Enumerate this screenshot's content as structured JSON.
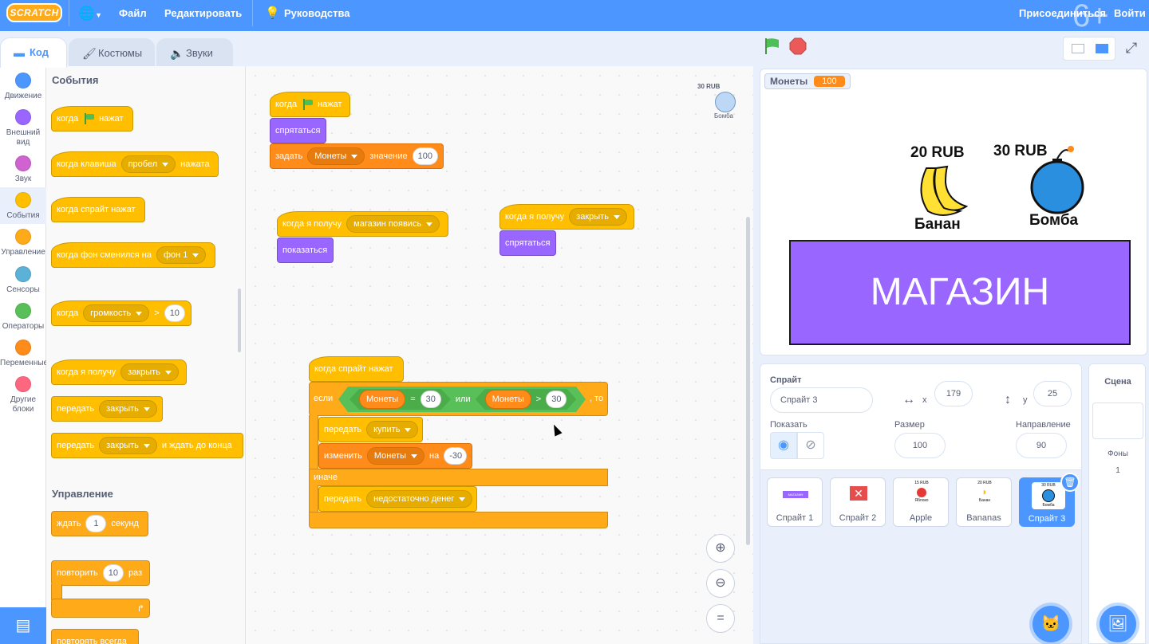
{
  "menubar": {
    "logo": "SCRATCH",
    "file": "Файл",
    "edit": "Редактировать",
    "tutorials": "Руководства",
    "join": "Присоединиться",
    "signin": "Войти",
    "age_badge": "6+"
  },
  "tabs": {
    "code": "Код",
    "costumes": "Костюмы",
    "sounds": "Звуки"
  },
  "categories": [
    {
      "label": "Движение",
      "color": "#4c97ff"
    },
    {
      "label": "Внешний вид",
      "color": "#9966ff"
    },
    {
      "label": "Звук",
      "color": "#cf63cf"
    },
    {
      "label": "События",
      "color": "#ffbf00"
    },
    {
      "label": "Управление",
      "color": "#ffab19"
    },
    {
      "label": "Сенсоры",
      "color": "#5cb1d6"
    },
    {
      "label": "Операторы",
      "color": "#59c059"
    },
    {
      "label": "Переменные",
      "color": "#ff8c1a"
    },
    {
      "label": "Другие блоки",
      "color": "#ff6680"
    }
  ],
  "palette": {
    "events_heading": "События",
    "control_heading": "Управление",
    "b1": {
      "when": "когда",
      "clicked": "нажат"
    },
    "b2": {
      "when": "когда клавиша",
      "key": "пробел",
      "pressed": "нажата"
    },
    "b3": {
      "text": "когда спрайт нажат"
    },
    "b4": {
      "text": "когда фон сменился на",
      "backdrop": "фон 1"
    },
    "b5": {
      "when": "когда",
      "prop": "громкость",
      "gt": ">",
      "value": "10"
    },
    "b6": {
      "text": "когда я получу",
      "msg": "закрыть"
    },
    "b7": {
      "text": "передать",
      "msg": "закрыть"
    },
    "b8": {
      "text": "передать",
      "msg": "закрыть",
      "tail": "и ждать до конца"
    },
    "c1": {
      "wait": "ждать",
      "value": "1",
      "sec": "секунд"
    },
    "c2": {
      "repeat": "повторить",
      "value": "10",
      "times": "раз"
    },
    "c3": {
      "forever": "повторять всегда"
    }
  },
  "script1": {
    "hat_when": "когда",
    "hat_clicked": "нажат",
    "hide": "спрятаться",
    "set": "задать",
    "var": "Монеты",
    "to": "значение",
    "value": "100"
  },
  "script2": {
    "hat": "когда я получу",
    "msg": "магазин появись",
    "show": "показаться"
  },
  "script3": {
    "hat": "когда я получу",
    "msg": "закрыть",
    "hide": "спрятаться"
  },
  "script4": {
    "hat": "когда спрайт нажат",
    "if": "если",
    "then": ", то",
    "else": "иначе",
    "var1": "Монеты",
    "eq": "=",
    "val1": "30",
    "or": "или",
    "var2": "Монеты",
    "gt": ">",
    "val2": "30",
    "broadcast": "передать",
    "msg_buy": "купить",
    "change": "изменить",
    "change_var": "Монеты",
    "by": "на",
    "delta": "-30",
    "broadcast2": "передать",
    "msg_nomoney": "недостаточно денег"
  },
  "code_sprite_preview": {
    "price": "30 RUB",
    "name": "Бомба"
  },
  "stage": {
    "monitor_name": "Монеты",
    "monitor_value": "100",
    "banana_price": "20 RUB",
    "banana_name": "Банан",
    "bomb_price": "30 RUB",
    "bomb_name": "Бомба",
    "shop": "МАГАЗИН"
  },
  "sprite_info": {
    "sprite_label": "Спрайт",
    "sprite_name": "Спрайт 3",
    "x_label": "x",
    "x": "179",
    "y_label": "y",
    "y": "25",
    "show_label": "Показать",
    "size_label": "Размер",
    "size": "100",
    "direction_label": "Направление",
    "direction": "90"
  },
  "sprites": [
    {
      "name": "Спрайт 1",
      "thumb": "МАГАЗИН"
    },
    {
      "name": "Спрайт 2",
      "thumb": ""
    },
    {
      "name": "Apple",
      "thumb_price": "15 RUB",
      "thumb_label": "Яблоко"
    },
    {
      "name": "Bananas",
      "thumb_price": "20 RUB",
      "thumb_label": "Банан"
    },
    {
      "name": "Спрайт 3",
      "thumb_price": "30 RUB",
      "thumb_label": "Бомба"
    }
  ],
  "scene": {
    "title": "Сцена",
    "backdrops_label": "Фоны",
    "backdrops_count": "1"
  }
}
